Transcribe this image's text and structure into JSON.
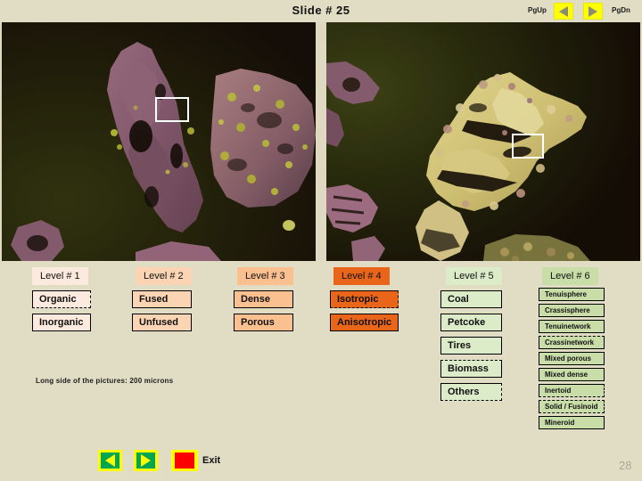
{
  "header": {
    "title": "Slide  # 25",
    "pgup_label": "PgUp",
    "pgdn_label": "PgDn",
    "pgup_icon": "triangle-left-icon",
    "pgdn_icon": "triangle-right-icon"
  },
  "images": {
    "caption": "Long side of the pictures: 200 microns",
    "left": {
      "name": "photomicrograph-left",
      "roi": "roi-marker-left"
    },
    "right": {
      "name": "photomicrograph-right",
      "roi": "roi-marker-right"
    }
  },
  "levels": [
    {
      "head": "Level # 1",
      "color": "#fdeade",
      "options": [
        {
          "label": "Organic",
          "selected": true,
          "sel_top": false
        },
        {
          "label": "Inorganic",
          "selected": false,
          "sel_top": false
        }
      ]
    },
    {
      "head": "Level # 2",
      "color": "#fbd4b4",
      "options": [
        {
          "label": "Fused",
          "selected": false,
          "sel_top": false
        },
        {
          "label": "Unfused",
          "selected": false,
          "sel_top": false
        }
      ]
    },
    {
      "head": "Level # 3",
      "color": "#fac090",
      "options": [
        {
          "label": "Dense",
          "selected": false,
          "sel_top": false
        },
        {
          "label": "Porous",
          "selected": false,
          "sel_top": false
        }
      ]
    },
    {
      "head": "Level # 4",
      "color": "#e8651a",
      "options": [
        {
          "label": "Isotropic",
          "selected": true,
          "sel_top": false
        },
        {
          "label": "Anisotropic",
          "selected": false,
          "sel_top": false
        }
      ]
    },
    {
      "head": "Level # 5",
      "color": "#dcebc8",
      "options": [
        {
          "label": "Coal",
          "selected": false,
          "sel_top": false
        },
        {
          "label": "Petcoke",
          "selected": false,
          "sel_top": false
        },
        {
          "label": "Tires",
          "selected": false,
          "sel_top": false
        },
        {
          "label": "Biomass",
          "selected": false,
          "sel_top": true
        },
        {
          "label": "Others",
          "selected": true,
          "sel_top": false
        }
      ]
    },
    {
      "head": "Level # 6",
      "color": "#c9dda8",
      "options": [
        {
          "label": "Tenuisphere",
          "selected": false,
          "sel_top": false
        },
        {
          "label": "Crassisphere",
          "selected": false,
          "sel_top": false
        },
        {
          "label": "Tenuinetwork",
          "selected": false,
          "sel_top": false
        },
        {
          "label": "Crassinetwork",
          "selected": false,
          "sel_top": true
        },
        {
          "label": "Mixed porous",
          "selected": false,
          "sel_top": false
        },
        {
          "label": "Mixed dense",
          "selected": false,
          "sel_top": false
        },
        {
          "label": "Inertoid",
          "selected": true,
          "sel_top": false
        },
        {
          "label": "Solid / Fusinoid",
          "selected": true,
          "sel_top": true
        },
        {
          "label": "Mineroid",
          "selected": false,
          "sel_top": false
        }
      ]
    }
  ],
  "footer": {
    "back_icon": "triangle-left-icon",
    "forward_icon": "triangle-right-icon",
    "exit_icon": "stop-square-icon",
    "exit_label": "Exit",
    "page_number": "28"
  },
  "colors": {
    "background": "#e0ddc4",
    "accent_yellow": "#ffff00",
    "accent_green": "#00a651",
    "accent_red": "#ff0000",
    "level4_orange": "#e8651a"
  }
}
